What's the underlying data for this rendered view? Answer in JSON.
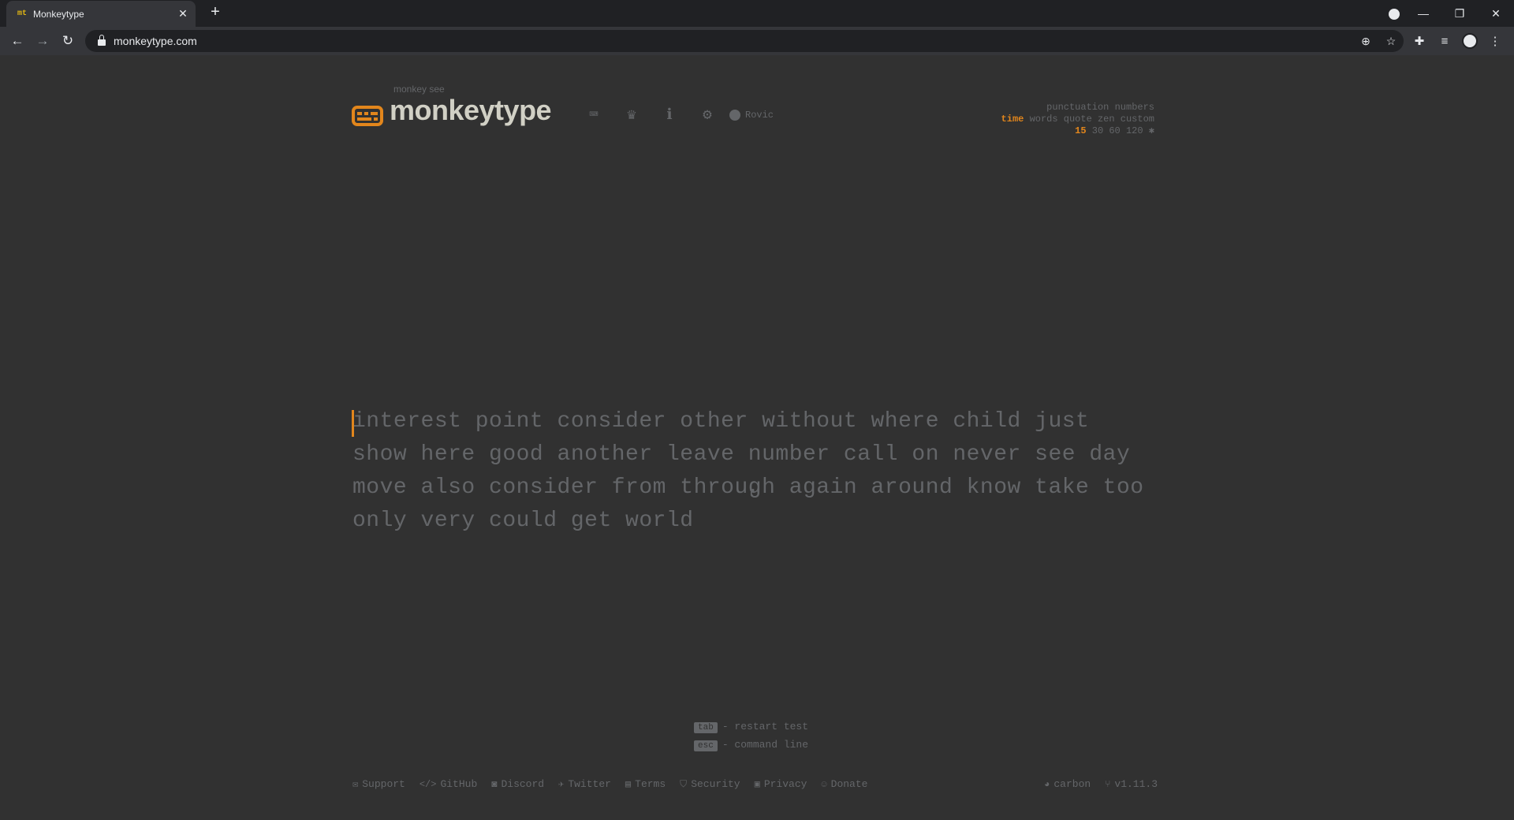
{
  "browser": {
    "tab_title": "Monkeytype",
    "tab_favicon": "mt",
    "url": "monkeytype.com"
  },
  "header": {
    "logo_subtitle": "monkey see",
    "logo_title": "monkeytype",
    "user_name": "Rovic"
  },
  "config": {
    "row1": "punctuation numbers",
    "mode_active": "time",
    "mode_rest": "words quote zen custom",
    "time_active": "15",
    "time_rest": "30 60 120",
    "accent_color": "#e2861c"
  },
  "test": {
    "words": "interest point consider other without where child just show here good another leave number call on never see day move also consider from through again around know take too only very could get world"
  },
  "hints": {
    "tab_key": "tab",
    "tab_text": "- restart test",
    "esc_key": "esc",
    "esc_text": "- command line"
  },
  "footer": {
    "support": "Support",
    "github": "GitHub",
    "discord": "Discord",
    "twitter": "Twitter",
    "terms": "Terms",
    "security": "Security",
    "privacy": "Privacy",
    "donate": "Donate",
    "theme": "carbon",
    "version": "v1.11.3"
  }
}
